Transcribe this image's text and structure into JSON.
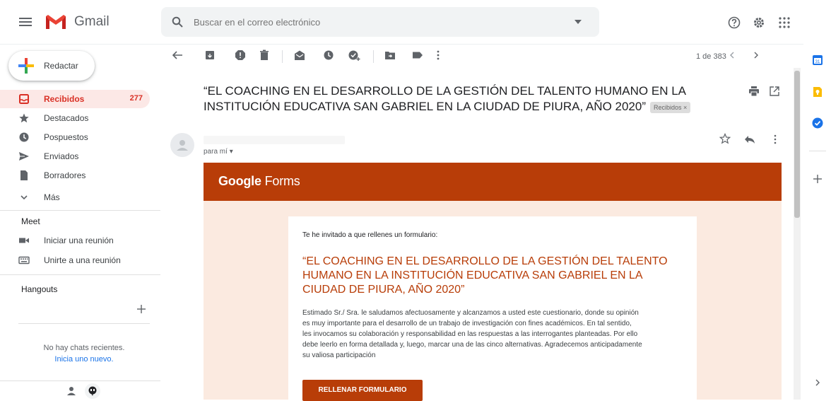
{
  "app": {
    "name": "Gmail"
  },
  "search": {
    "placeholder": "Buscar en el correo electrónico"
  },
  "sidebar": {
    "compose_label": "Redactar",
    "items": [
      {
        "label": "Recibidos",
        "count": "277",
        "icon": "inbox-icon",
        "active": true
      },
      {
        "label": "Destacados",
        "icon": "star-icon"
      },
      {
        "label": "Pospuestos",
        "icon": "clock-icon"
      },
      {
        "label": "Enviados",
        "icon": "send-icon"
      },
      {
        "label": "Borradores",
        "icon": "draft-icon"
      },
      {
        "label": "Más",
        "icon": "chevron-down-icon"
      }
    ],
    "meet": {
      "title": "Meet",
      "items": [
        {
          "label": "Iniciar una reunión",
          "icon": "video-icon"
        },
        {
          "label": "Unirte a una reunión",
          "icon": "keyboard-icon"
        }
      ]
    },
    "hangouts": {
      "title": "Hangouts",
      "no_chats": "No hay chats recientes.",
      "start_new": "Inicia uno nuevo."
    }
  },
  "toolbar": {
    "pagination": "1 de 383"
  },
  "message": {
    "subject_line1": "“EL COACHING EN EL DESARROLLO DE LA GESTIÓN DEL TALENTO HUMANO EN LA",
    "subject_line2": "INSTITUCIÓN EDUCATIVA SAN GABRIEL EN LA CIUDAD DE PIURA, AÑO 2020”",
    "label_chip": "Recibidos ×",
    "to": "para mí"
  },
  "form": {
    "brand_google": "Google",
    "brand_forms": " Forms",
    "intro": "Te he invitado a que rellenes un formulario:",
    "title_line1": "“EL COACHING EN EL DESARROLLO DE LA GESTIÓN DEL TALENTO",
    "title_line2": "HUMANO EN LA INSTITUCIÓN EDUCATIVA SAN GABRIEL EN LA",
    "title_line3": "CIUDAD DE PIURA, AÑO 2020”",
    "body_lines": [
      "Estimado Sr./ Sra. le saludamos afectuosamente y alcanzamos a usted este cuestionario, donde su opinión",
      "es muy importante para el desarrollo de un trabajo de investigación con fines académicos. En tal sentido,",
      "les invocamos su colaboración y responsabilidad en las respuestas a las interrogantes planteadas. Por ello",
      "debe leerlo en forma detallada y, luego, marcar una de las cinco alternativas. Agradecemos anticipadamente",
      "su valiosa participación"
    ],
    "button": "RELLENAR FORMULARIO"
  },
  "colors": {
    "accent_red": "#d93025",
    "forms_brand": "#b83d08",
    "form_bg": "#fbeae0"
  }
}
